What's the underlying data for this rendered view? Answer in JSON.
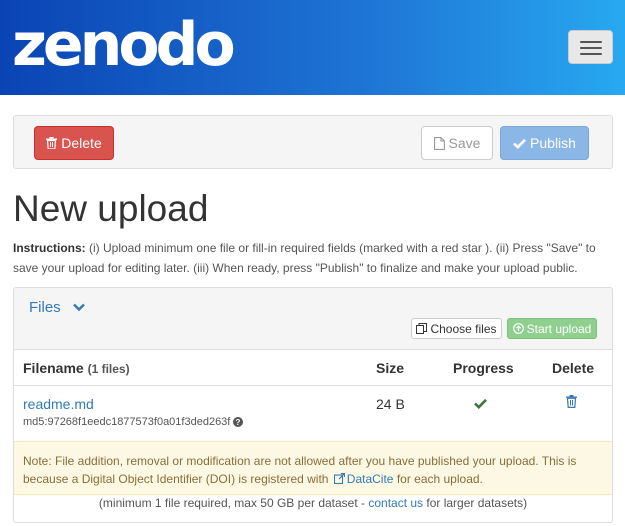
{
  "header": {
    "logo": "zenodo",
    "menu_icon": "hamburger-menu-icon"
  },
  "toolbar": {
    "delete_label": "Delete",
    "save_label": "Save",
    "publish_label": "Publish"
  },
  "page": {
    "title": "New upload",
    "instructions_label": "Instructions:",
    "instructions_text": " (i) Upload minimum one file or fill-in required fields (marked with a red star ). (ii) Press \"Save\" to save your upload for editing later. (iii) When ready, press \"Publish\" to finalize and make your upload public."
  },
  "files": {
    "toggle_label": "Files",
    "choose_label": "Choose files",
    "start_label": "Start upload",
    "columns": {
      "filename": "Filename",
      "filename_count": "(1 files)",
      "size": "Size",
      "progress": "Progress",
      "delete": "Delete"
    },
    "rows": [
      {
        "name": "readme.md",
        "checksum": "md5:97268f1eedc1877573f0a01f3ded263f",
        "size": "24 B",
        "progress_icon": "check-icon",
        "delete_icon": "trash-icon"
      }
    ],
    "note_before": "Note: File addition, removal or modification are not allowed after you have published your upload. This is because a Digital Object Identifier (DOI) is registered with ",
    "note_link": "DataCite",
    "note_after": " for each upload.",
    "footer_before": "(minimum 1 file required, max 50 GB per dataset - ",
    "footer_link": "contact us",
    "footer_after": " for larger datasets)"
  },
  "colors": {
    "brand_start": "#0a44b4",
    "brand_end": "#27a9f0",
    "danger": "#d9534f",
    "primary_disabled": "#8bb7e6",
    "success_disabled": "#8fd08f",
    "link": "#337ab7",
    "success": "#3c763d",
    "warning_bg": "#fcf8e3"
  }
}
